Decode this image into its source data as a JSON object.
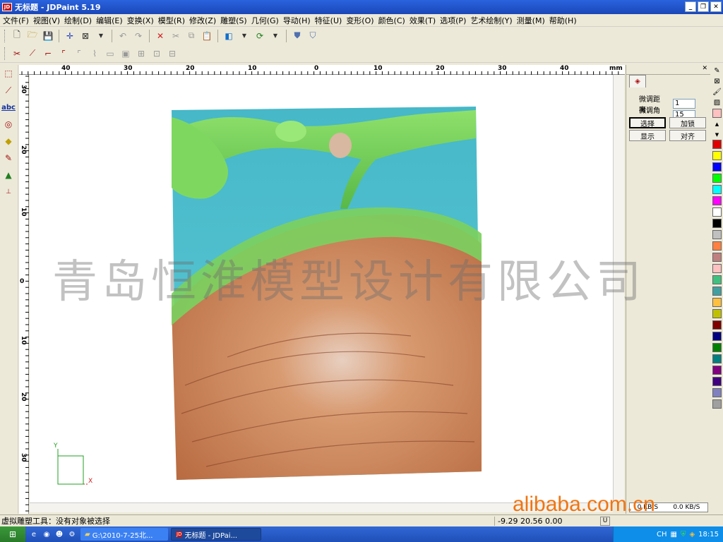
{
  "window": {
    "title": "无标题 - JDPaint 5.19",
    "logo": "JD",
    "buttons": [
      "_",
      "❐",
      "✕"
    ]
  },
  "menu": [
    "文件(F)",
    "视图(V)",
    "绘制(D)",
    "编辑(E)",
    "变换(X)",
    "模型(R)",
    "修改(Z)",
    "雕塑(S)",
    "几何(G)",
    "导动(H)",
    "特征(U)",
    "变形(O)",
    "颜色(C)",
    "效果(T)",
    "选项(P)",
    "艺术绘制(Y)",
    "测量(M)",
    "帮助(H)"
  ],
  "ruler": {
    "unit": "mm",
    "h_labels": [
      "40",
      "30",
      "20",
      "10",
      "0",
      "10",
      "20",
      "30",
      "40"
    ],
    "v_labels": [
      "30",
      "20",
      "10",
      "0",
      "10",
      "20",
      "30"
    ]
  },
  "right_panel": {
    "fine_distance_label": "微调距离：",
    "fine_distance_value": "1",
    "fine_angle_label": "微调角度：",
    "fine_angle_value": "15",
    "buttons": {
      "select": "选择",
      "lock": "加锁",
      "show": "显示",
      "align": "对齐"
    },
    "speed_left": "0 KB/S",
    "speed_right": "0.0 KB/S"
  },
  "palette": [
    "#e00000",
    "#ffff00",
    "#0000ff",
    "#00ff00",
    "#00ffff",
    "#ff00ff",
    "#ffffff",
    "#000000",
    "#c0c0c0",
    "#ff8040",
    "#c08080",
    "#ffc0c0",
    "#40c080",
    "#40a0a0",
    "#ffc040",
    "#c0c000",
    "#800000",
    "#000080",
    "#008000",
    "#008080",
    "#800080",
    "#400080",
    "#8080c0",
    "#a0a0a0"
  ],
  "status": {
    "tool": "虚拟雕塑工具：没有对象被选择",
    "coords": "-9.29 20.56 0.00",
    "unit_btn": "U"
  },
  "taskbar": {
    "window1": "G:\\2010-7-25北...",
    "window2": "无标题 - JDPai...",
    "lang": "CH",
    "time": "18:15"
  },
  "watermarks": {
    "company": "青岛恒淮模型设计有限公司",
    "site": "alibaba.com.cn"
  },
  "axis": {
    "y": "Y",
    "x": "X"
  }
}
